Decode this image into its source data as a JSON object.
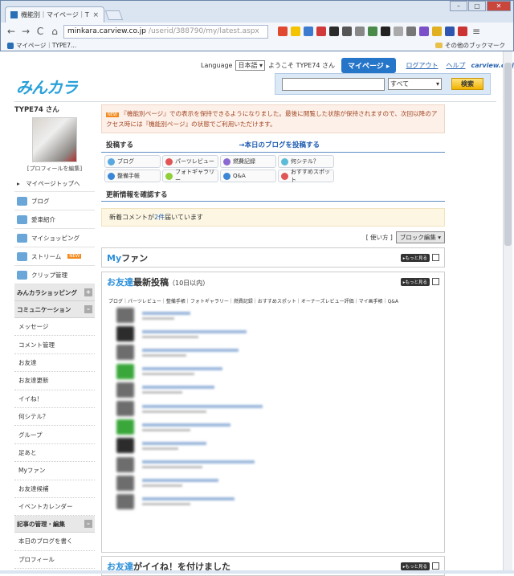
{
  "browser": {
    "tab_title": "機能別｜マイページ｜TYP",
    "tab_close": "×",
    "window_buttons": [
      "–",
      "▢",
      "✕"
    ],
    "url_prefix": "minkara.carview.co.jp",
    "url_path": "/userid/388790/my/latest.aspx",
    "bookmark_label": "マイページ｜TYPE7...",
    "other_bookmarks": "その他のブックマーク",
    "nav_back": "←",
    "nav_forward": "→",
    "nav_reload": "C",
    "nav_home": "⌂",
    "menu": "≡"
  },
  "header": {
    "logo": "みんカラ",
    "language_label": "Language",
    "language_value": "日本語",
    "welcome": "ようこそ TYPE74 さん",
    "mypage_button": "マイページ ▸",
    "logout": "ログアウト",
    "help": "ヘルプ",
    "carview": "carview.co.jp",
    "search_scope": "すべて",
    "search_button": "検索",
    "search_placeholder": ""
  },
  "sidebar": {
    "username": "TYPE74 さん",
    "profile_edit": "[プロフィールを編集]",
    "mypage_top": "▸　マイページトップへ",
    "items": [
      {
        "label": "ブログ",
        "new": ""
      },
      {
        "label": "愛車紹介",
        "new": ""
      },
      {
        "label": "マイショッピング",
        "new": ""
      },
      {
        "label": "ストリーム",
        "new": "NEW"
      },
      {
        "label": "クリップ管理",
        "new": ""
      }
    ],
    "shopping_section": "みんカラショッピング",
    "comm_section": "コミュニケーション",
    "comm_items": [
      "メッセージ",
      "コメント管理",
      "お友達",
      "お友達更新",
      "イイね！",
      "何シテル？",
      "グループ",
      "足あと",
      "Myファン",
      "お友達候補",
      "イベントカレンダー"
    ],
    "article_section": "記事の管理・編集",
    "article_items": [
      "本日のブログを書く",
      "プロフィール"
    ]
  },
  "main": {
    "notice_badge": "NEW",
    "notice_text": "『機能別ページ』での表示を保持できるようになりました。最後に閲覧した状態が保持されますので、次回以降のアクセス時には『機能別ページ』の状態でご利用いただけます。",
    "post_title": "投稿する",
    "post_today": "→本日のブログを投稿する",
    "post_buttons": [
      {
        "label": "ブログ",
        "color": "#5aa8e0"
      },
      {
        "label": "パーツレビュー",
        "color": "#e05555"
      },
      {
        "label": "燃費記録",
        "color": "#8a6ad0"
      },
      {
        "label": "何シテル？",
        "color": "#5bbbd9"
      },
      {
        "label": "整備手帳",
        "color": "#3b86d6"
      },
      {
        "label": "フォトギャラリー",
        "color": "#8fcf3a"
      },
      {
        "label": "Q&A",
        "color": "#3b86d6"
      },
      {
        "label": "おすすめスポット",
        "color": "#e05555"
      }
    ],
    "update_title": "更新情報を確認する",
    "update_text_a": "新着コメントが",
    "update_link": "2件",
    "update_text_b": "届いています",
    "usage": "[ 使い方 ]",
    "block_edit": "ブロック編集 ▾",
    "myfan_title_a": "My",
    "myfan_title_b": "ファン",
    "more": "▸もっと見る",
    "friends_title_a": "お友達",
    "friends_title_b": "最新投稿",
    "friends_title_c": "（10日以内）",
    "friends_tabs": "ブログ｜パーツレビュー｜整備手帳｜フォトギャラリー｜燃費記録｜おすすめスポット｜オーナーズレビュー評価｜マイ画手帳｜Q&A",
    "likes_title_a": "お友達",
    "likes_title_b": "がイイね！",
    "likes_title_c": "を付けました"
  }
}
